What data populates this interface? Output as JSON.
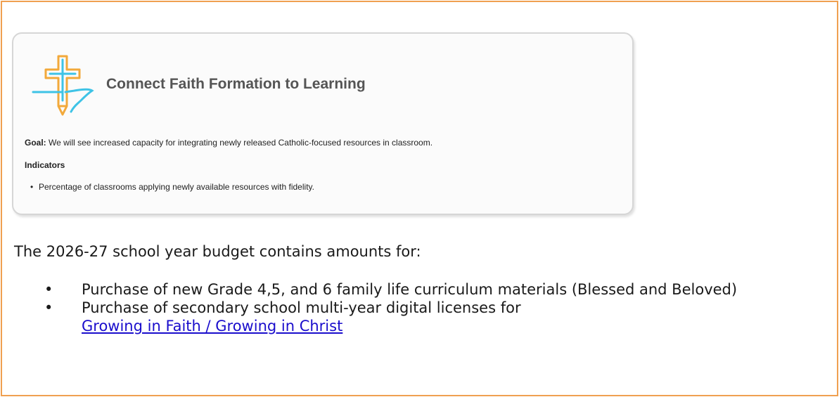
{
  "card": {
    "title": "Connect Faith Formation to Learning",
    "goal_label": "Goal:",
    "goal_text": " We will see increased capacity for integrating newly released Catholic-focused resources in classroom.",
    "indicators_heading": "Indicators",
    "indicators": [
      "Percentage of classrooms applying newly available resources with fidelity."
    ]
  },
  "budget": {
    "intro": "The 2026-27 school year budget contains amounts for:",
    "item1": "Purchase of new Grade 4,5, and 6 family life curriculum materials (Blessed and Beloved)",
    "item2": "Purchase of secondary school multi-year digital licenses for",
    "item2_link": "Growing in Faith / Growing in Christ"
  },
  "colors": {
    "frame_border": "#f0a050",
    "logo_orange": "#f2a93b",
    "logo_blue": "#3ec3e6",
    "link": "#1a0dcc"
  },
  "icons": {
    "logo": "cross-pencil-logo-icon",
    "bullet": "bullet-icon"
  }
}
